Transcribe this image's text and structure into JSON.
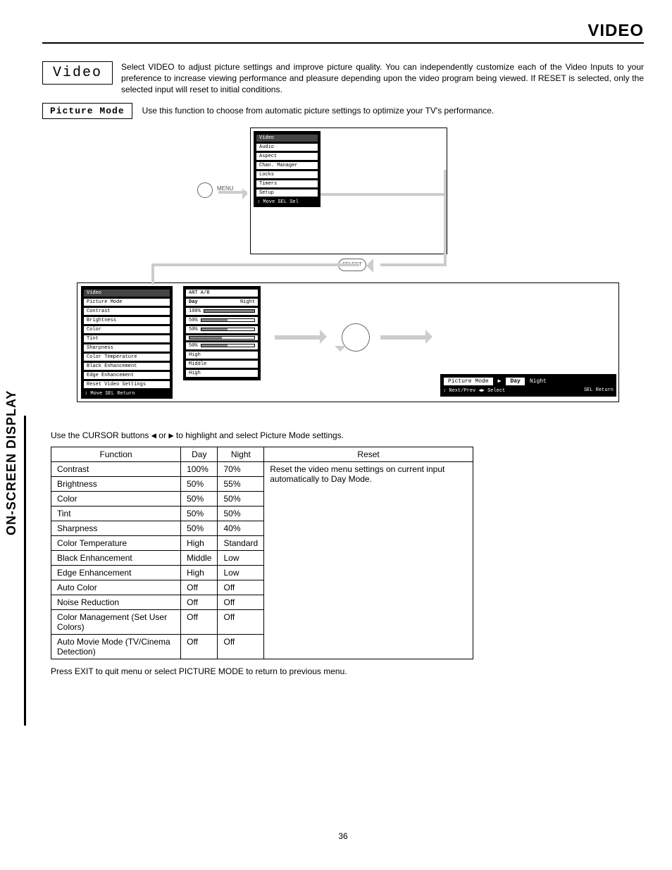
{
  "header": {
    "title": "VIDEO"
  },
  "intro": {
    "box_label": "Video",
    "text": "Select VIDEO to adjust picture settings and improve picture quality.  You can independently customize each of the Video Inputs to your preference to increase viewing performance and pleasure depending upon the video program being viewed.  If RESET is selected, only the selected input will reset to initial conditions."
  },
  "picture_mode": {
    "label": "Picture Mode",
    "text": "Use this function to choose from automatic picture settings to optimize your TV's performance."
  },
  "diagram": {
    "menu_button": "MENU",
    "select_button": "SELECT",
    "main_menu": {
      "items": [
        "Video",
        "Audio",
        "Aspect",
        "Chan. Manager",
        "Locks",
        "Timers",
        "Setup"
      ],
      "footer_left": "Move",
      "footer_right": "Sel"
    },
    "video_menu": {
      "title": "Video",
      "items": [
        "Picture Mode",
        "Contrast",
        "Brightness",
        "Color",
        "Tint",
        "Sharpness",
        "Color Temperature",
        "Black Enhancement",
        "Edge Enhancement",
        "Reset Video Settings"
      ],
      "footer_left": "Move",
      "footer_right": "Return"
    },
    "values": {
      "title": "ANT A/B",
      "rows": [
        {
          "label": "Day",
          "right": "Night"
        },
        {
          "label": "100%",
          "pct": 100
        },
        {
          "label": "50%",
          "pct": 50
        },
        {
          "label": "50%",
          "pct": 50
        },
        {
          "label": "",
          "pct": 50,
          "tint": true
        },
        {
          "label": "50%",
          "pct": 50
        },
        {
          "label": "High"
        },
        {
          "label": "Middle"
        },
        {
          "label": "High"
        }
      ]
    },
    "pm_osd": {
      "label": "Picture Mode",
      "day": "Day",
      "night": "Night",
      "next": "Next/Prev",
      "select": "Select",
      "ret": "Return"
    }
  },
  "below_text": {
    "cursor_line_pre": "Use the CURSOR buttons ",
    "cursor_line_post": " to highlight and select Picture Mode settings.",
    "left_arrow": "◀",
    "or": " or ",
    "right_arrow": "▶"
  },
  "table": {
    "headers": [
      "Function",
      "Day",
      "Night",
      "Reset"
    ],
    "reset_text": "Reset the video menu settings on current input automatically to Day Mode.",
    "rows": [
      {
        "fn": "Contrast",
        "day": "100%",
        "night": "70%"
      },
      {
        "fn": "Brightness",
        "day": "50%",
        "night": "55%"
      },
      {
        "fn": "Color",
        "day": "50%",
        "night": "50%"
      },
      {
        "fn": "Tint",
        "day": "50%",
        "night": "50%"
      },
      {
        "fn": "Sharpness",
        "day": "50%",
        "night": "40%"
      },
      {
        "fn": "Color Temperature",
        "day": "High",
        "night": "Standard"
      },
      {
        "fn": "Black Enhancement",
        "day": "Middle",
        "night": "Low"
      },
      {
        "fn": "Edge Enhancement",
        "day": "High",
        "night": "Low"
      },
      {
        "fn": "Auto Color",
        "day": "Off",
        "night": "Off"
      },
      {
        "fn": "Noise Reduction",
        "day": "Off",
        "night": "Off"
      },
      {
        "fn": "Color Management (Set User Colors)",
        "day": "Off",
        "night": "Off"
      },
      {
        "fn": "Auto Movie Mode (TV/Cinema Detection)",
        "day": "Off",
        "night": "Off"
      }
    ]
  },
  "footer_text": "Press EXIT to quit menu or select PICTURE MODE to return to previous menu.",
  "side_label": "ON-SCREEN DISPLAY",
  "page_number": "36"
}
